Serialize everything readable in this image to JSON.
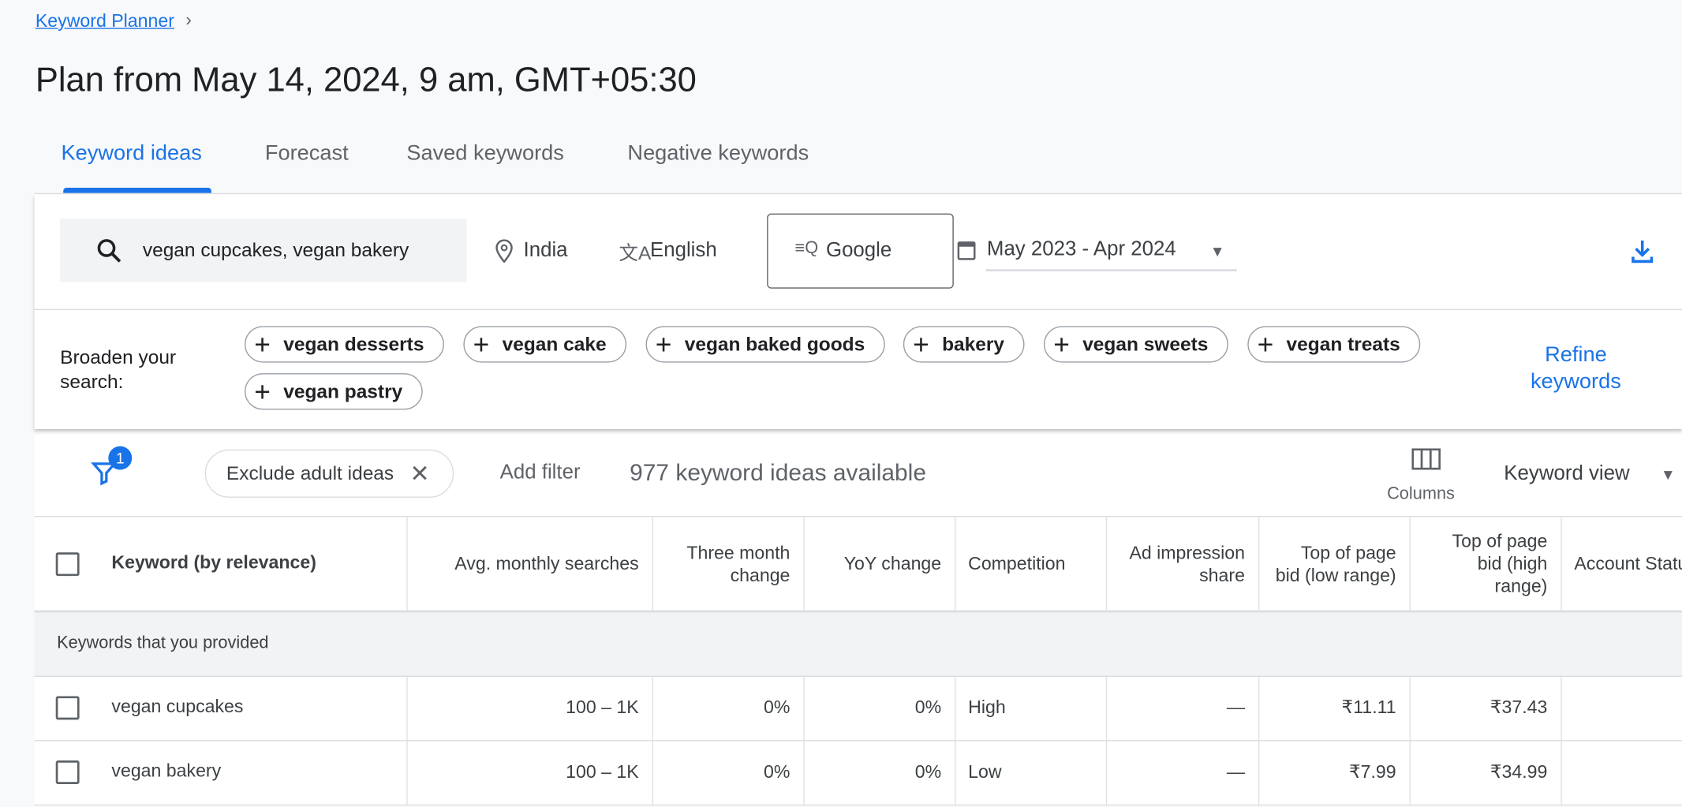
{
  "breadcrumb": {
    "label": "Keyword Planner"
  },
  "title": "Plan from May 14, 2024, 9 am, GMT+05:30",
  "tabs": [
    {
      "label": "Keyword ideas",
      "active": true
    },
    {
      "label": "Forecast"
    },
    {
      "label": "Saved keywords"
    },
    {
      "label": "Negative keywords"
    }
  ],
  "search": {
    "value": "vegan cupcakes, vegan bakery",
    "location": "India",
    "language": "English",
    "network": "Google",
    "date_range": "May 2023 - Apr 2024"
  },
  "broaden": {
    "label": "Broaden your search:",
    "chips": [
      "vegan desserts",
      "vegan cake",
      "vegan baked goods",
      "bakery",
      "vegan sweets",
      "vegan treats",
      "vegan pastry"
    ],
    "refine": "Refine keywords"
  },
  "filters": {
    "badge": "1",
    "chip": "Exclude adult ideas",
    "add_filter": "Add filter",
    "count": "977 keyword ideas available",
    "columns": "Columns",
    "view": "Keyword view"
  },
  "table": {
    "headers": [
      "Keyword (by relevance)",
      "Avg. monthly searches",
      "Three month change",
      "YoY change",
      "Competition",
      "Ad impression share",
      "Top of page bid (low range)",
      "Top of page bid (high range)",
      "Account Status"
    ],
    "group": "Keywords that you provided",
    "rows": [
      [
        "vegan cupcakes",
        "100 – 1K",
        "0%",
        "0%",
        "High",
        "—",
        "₹11.11",
        "₹37.43",
        ""
      ],
      [
        "vegan bakery",
        "100 – 1K",
        "0%",
        "0%",
        "Low",
        "—",
        "₹7.99",
        "₹34.99",
        ""
      ]
    ]
  },
  "colors": {
    "accent": "#1a73e8",
    "background": "#f8f9fa",
    "group_row": "#f1f3f4"
  }
}
